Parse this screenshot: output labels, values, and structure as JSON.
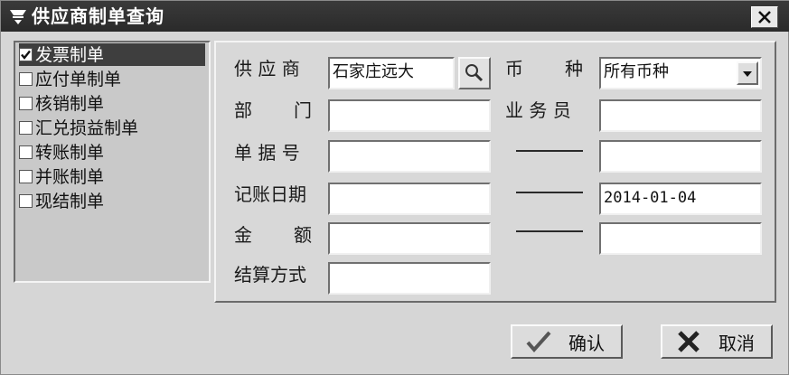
{
  "window": {
    "title": "供应商制单查询",
    "close_symbol": "✕"
  },
  "list": {
    "items": [
      {
        "label": "发票制单",
        "checked": true,
        "selected": true
      },
      {
        "label": "应付单制单",
        "checked": false
      },
      {
        "label": "核销制单",
        "checked": false
      },
      {
        "label": "汇兑损益制单",
        "checked": false
      },
      {
        "label": "转账制单",
        "checked": false
      },
      {
        "label": "并账制单",
        "checked": false
      },
      {
        "label": "现结制单",
        "checked": false
      }
    ]
  },
  "form": {
    "supplier_label": "供 应 商",
    "supplier_value": "石家庄远大",
    "currency_label_1": "币",
    "currency_label_2": "种",
    "currency_value": "所有币种",
    "dept_label_1": "部",
    "dept_label_2": "门",
    "dept_value": "",
    "salesman_label": "业 务 员",
    "salesman_value": "",
    "doc_no_label": "单 据 号",
    "doc_no_from": "",
    "doc_no_to": "",
    "date_label": "记账日期",
    "date_from": "",
    "date_to": "2014-01-04",
    "amount_label_1": "金",
    "amount_label_2": "额",
    "amount_from": "",
    "amount_to": "",
    "settle_label": "结算方式",
    "settle_value": ""
  },
  "buttons": {
    "ok_label": "确认",
    "cancel_label": "取消"
  },
  "icons": {
    "title": "window-icon",
    "search": "magnifier-icon",
    "dropdown": "chevron-down-icon",
    "ok": "checkmark-icon",
    "cancel": "cross-icon",
    "close": "close-icon",
    "checkbox_check": "checkmark-icon"
  }
}
